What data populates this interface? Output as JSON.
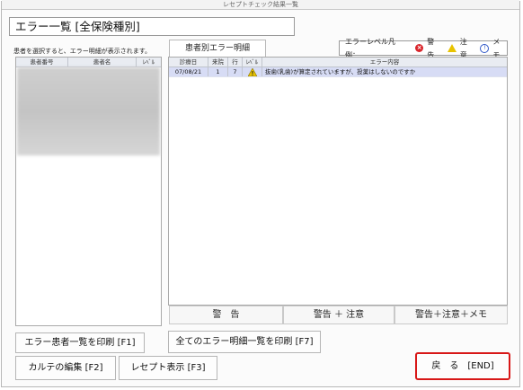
{
  "window": {
    "title": "レセプトチェック結果一覧"
  },
  "page_title": "エラー一覧 [全保険種別]",
  "hint": "患者を選択すると、エラー明細が表示されます。",
  "tab_label": "患者別エラー明細",
  "legend": {
    "label": "エラーレベル凡例：",
    "error": "警告",
    "warning": "注意",
    "memo": "メモ",
    "colors": {
      "error": "#d9252b",
      "warning": "#e8c300",
      "memo": "#3058c8"
    }
  },
  "patients": {
    "columns": [
      "患者番号",
      "患者名",
      "ﾚﾍﾞﾙ"
    ]
  },
  "errors": {
    "columns": [
      "診療日",
      "来院",
      "行",
      "ﾚﾍﾞﾙ",
      "エラー内容"
    ],
    "rows": [
      {
        "date": "07/08/21",
        "visit": "1",
        "line": "7",
        "level_icon": "warning-icon",
        "message": "抜歯(乳歯)が算定されていますが、投薬はしないのですか"
      }
    ],
    "selected_row_color": "#d7dcf5"
  },
  "subtabs": [
    "警　告",
    "警告 ＋ 注意",
    "警告＋注意＋メモ"
  ],
  "buttons": {
    "print_patients": "エラー患者一覧を印刷 [F1]",
    "print_all": "全てのエラー明細一覧を印刷 [F7]",
    "edit_chart": "カルテの編集 [F2]",
    "show_receipt": "レセプト表示 [F3]",
    "back": "戻　る　[END]"
  }
}
